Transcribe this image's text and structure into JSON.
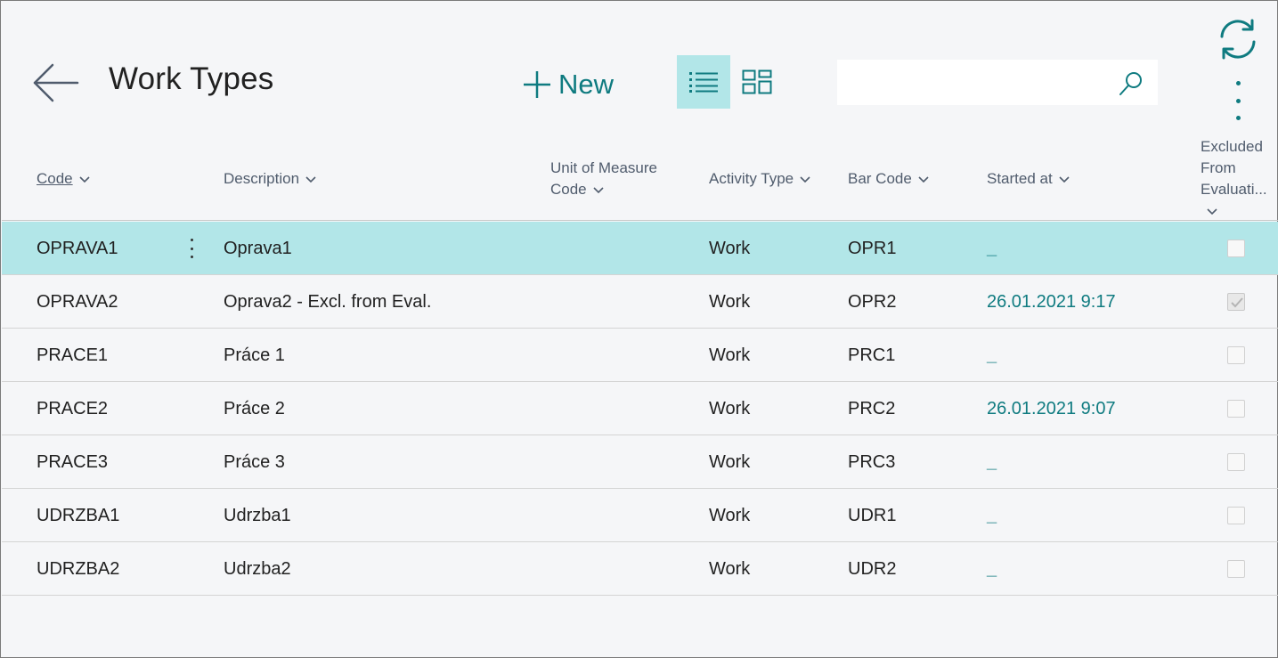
{
  "page": {
    "title": "Work Types"
  },
  "toolbar": {
    "new_label": "New"
  },
  "search": {
    "placeholder": "",
    "value": ""
  },
  "columns": {
    "code": "Code",
    "description": "Description",
    "uom_line1": "Unit of Measure",
    "uom_line2": "Code",
    "activity_type": "Activity Type",
    "bar_code": "Bar Code",
    "started_at": "Started at",
    "excluded_line1": "Excluded",
    "excluded_line2": "From",
    "excluded_line3": "Evaluati..."
  },
  "rows": [
    {
      "code": "OPRAVA1",
      "description": "Oprava1",
      "activity_type": "Work",
      "bar_code": "OPR1",
      "started_at": "_",
      "excluded": false,
      "selected": true
    },
    {
      "code": "OPRAVA2",
      "description": "Oprava2 - Excl. from Eval.",
      "activity_type": "Work",
      "bar_code": "OPR2",
      "started_at": "26.01.2021 9:17",
      "excluded": true,
      "selected": false
    },
    {
      "code": "PRACE1",
      "description": "Práce 1",
      "activity_type": "Work",
      "bar_code": "PRC1",
      "started_at": "_",
      "excluded": false,
      "selected": false
    },
    {
      "code": "PRACE2",
      "description": "Práce 2",
      "activity_type": "Work",
      "bar_code": "PRC2",
      "started_at": "26.01.2021 9:07",
      "excluded": false,
      "selected": false
    },
    {
      "code": "PRACE3",
      "description": "Práce 3",
      "activity_type": "Work",
      "bar_code": "PRC3",
      "started_at": "_",
      "excluded": false,
      "selected": false
    },
    {
      "code": "UDRZBA1",
      "description": "Udrzba1",
      "activity_type": "Work",
      "bar_code": "UDR1",
      "started_at": "_",
      "excluded": false,
      "selected": false
    },
    {
      "code": "UDRZBA2",
      "description": "Udrzba2",
      "activity_type": "Work",
      "bar_code": "UDR2",
      "started_at": "_",
      "excluded": false,
      "selected": false
    }
  ],
  "colors": {
    "accent": "#0f7b80",
    "selected_row": "#b2e6e8",
    "background": "#f5f6f8"
  },
  "icons": [
    "back-arrow-icon",
    "plus-icon",
    "list-view-icon",
    "tile-view-icon",
    "search-icon",
    "refresh-icon",
    "more-vertical-icon",
    "chevron-down-icon",
    "row-actions-icon",
    "checkmark-icon"
  ]
}
